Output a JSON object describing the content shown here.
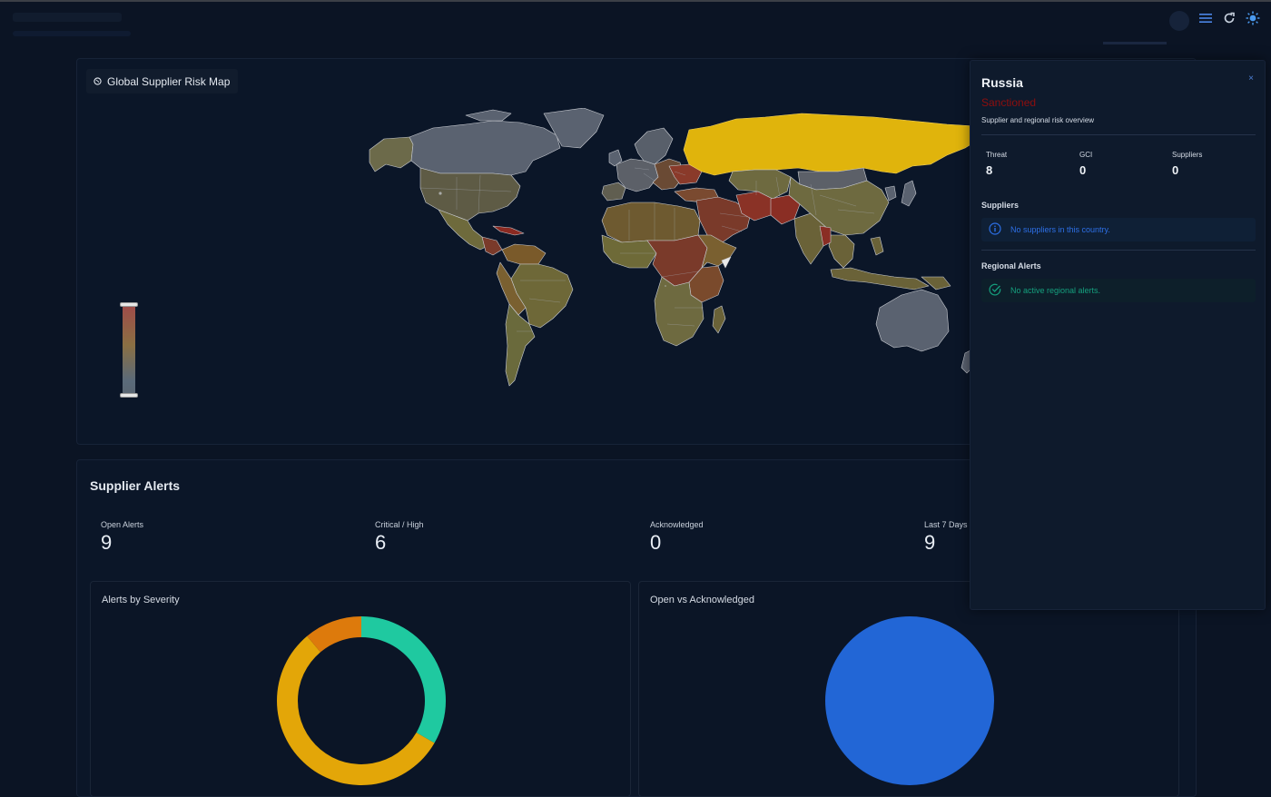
{
  "map": {
    "title": "Global Supplier Risk Map"
  },
  "panel": {
    "country": "Russia",
    "status": "Sanctioned",
    "subtitle": "Supplier and regional risk overview",
    "close": "×",
    "metrics": [
      {
        "label": "Threat",
        "value": "8"
      },
      {
        "label": "GCI",
        "value": "0"
      },
      {
        "label": "Suppliers",
        "value": "0"
      }
    ],
    "suppliers_heading": "Suppliers",
    "suppliers_notice": "No suppliers in this country.",
    "alerts_heading": "Regional Alerts",
    "alerts_notice": "No active regional alerts."
  },
  "alerts": {
    "title": "Supplier Alerts",
    "stats": [
      {
        "label": "Open Alerts",
        "value": "9"
      },
      {
        "label": "Critical / High",
        "value": "6"
      },
      {
        "label": "Acknowledged",
        "value": "0"
      },
      {
        "label": "Last 7 Days",
        "value": "9"
      }
    ],
    "severity_chart_title": "Alerts by Severity",
    "ack_chart_title": "Open vs Acknowledged"
  },
  "chart_data": [
    {
      "type": "pie",
      "variant": "donut",
      "title": "Alerts by Severity",
      "slices": [
        {
          "value": 3,
          "color": "#1fc9a0"
        },
        {
          "value": 5,
          "color": "#e3a608"
        },
        {
          "value": 1,
          "color": "#dd7a0c"
        }
      ]
    },
    {
      "type": "pie",
      "title": "Open vs Acknowledged",
      "slices": [
        {
          "value": 9,
          "color": "#2266d6"
        },
        {
          "value": 0,
          "color": "#1fc9a0"
        }
      ]
    }
  ],
  "colors": {
    "background": "#0b1424",
    "card": "#0b1628",
    "accent": "#2d6fe6",
    "sanctioned": "#8f0e0e",
    "success": "#15a07e"
  },
  "icons": [
    "menu-icon",
    "refresh-icon",
    "theme-icon",
    "globe-icon",
    "info-icon",
    "check-circle-icon",
    "close-icon"
  ]
}
